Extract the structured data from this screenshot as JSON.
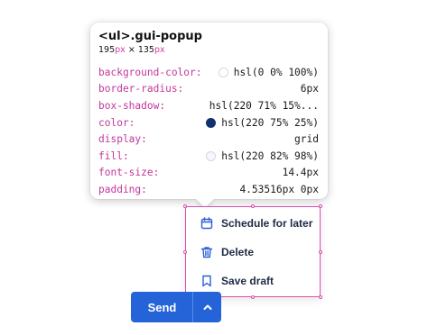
{
  "inspector": {
    "title": "<ul>.gui-popup",
    "width_value": "195",
    "height_value": "135",
    "unit": "px",
    "times": "×",
    "properties": [
      {
        "name": "background-color:",
        "value": "hsl(0 0% 100%)",
        "swatch": "#ffffff"
      },
      {
        "name": "border-radius:",
        "value": "6px"
      },
      {
        "name": "box-shadow:",
        "value": "hsl(220 71% 15%..."
      },
      {
        "name": "color:",
        "value": "hsl(220 75% 25%)",
        "swatch": "#10306f"
      },
      {
        "name": "display:",
        "value": "grid"
      },
      {
        "name": "fill:",
        "value": "hsl(220 82% 98%)",
        "swatch": "#f5f8fe"
      },
      {
        "name": "font-size:",
        "value": "14.4px"
      },
      {
        "name": "padding:",
        "value": "4.53516px 0px"
      }
    ]
  },
  "menu": {
    "items": [
      {
        "label": "Schedule for later",
        "icon": "calendar-icon"
      },
      {
        "label": "Delete",
        "icon": "trash-icon"
      },
      {
        "label": "Save draft",
        "icon": "bookmark-icon"
      }
    ],
    "highlight_color": "#d94fae"
  },
  "send": {
    "label": "Send",
    "accent": "#2563d9"
  }
}
